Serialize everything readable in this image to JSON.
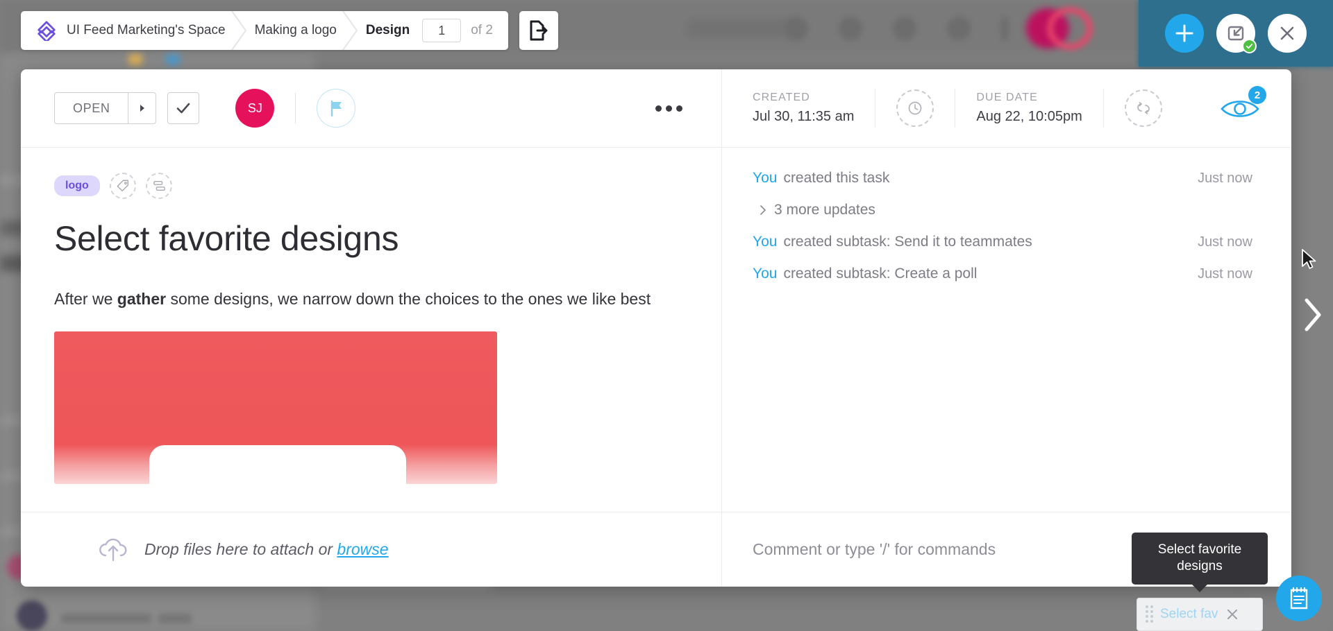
{
  "breadcrumb": {
    "items": [
      {
        "label": "UI Feed Marketing's Space",
        "active": false
      },
      {
        "label": "Making a logo",
        "active": false
      },
      {
        "label": "Design",
        "active": true
      }
    ],
    "page_value": "1",
    "page_total": "of 2",
    "export_icon": "export-document-icon"
  },
  "action_cluster": {
    "add_label": "+",
    "add_icon": "plus-icon",
    "minimize_icon": "minimize-task-icon",
    "minimize_status_icon": "green-check-badge",
    "close_icon": "close-x-icon"
  },
  "task_header": {
    "status_label": "OPEN",
    "status_caret_icon": "caret-right-icon",
    "complete_icon": "checkmark-icon",
    "avatar_initials": "SJ",
    "flag_icon": "flag-icon",
    "more_icon": "ellipsis-icon",
    "created_label": "CREATED",
    "created_value": "Jul 30, 11:35 am",
    "time_estimate_icon": "clock-icon",
    "due_label": "DUE DATE",
    "due_value": "Aug 22, 10:05pm",
    "recurring_icon": "repeat-icon",
    "watch_icon": "eye-icon",
    "watch_count": "2"
  },
  "task_body": {
    "tag": "logo",
    "add_tag_icon": "tag-icon",
    "add_field_icon": "custom-field-icon",
    "title": "Select favorite designs",
    "description_prefix": "After we ",
    "description_bold": "gather",
    "description_suffix": " some designs, we narrow down the choices to the ones we like best",
    "attachment_preview": "design-thumbnail",
    "dropzone_icon": "upload-cloud-icon",
    "dropzone_text": "Drop files here to attach or ",
    "dropzone_link": "browse"
  },
  "activity": {
    "items": [
      {
        "who": "You",
        "what": "created this task",
        "when": "Just now"
      },
      {
        "who": "You",
        "what": "created subtask: Send it to teammates",
        "when": "Just now"
      },
      {
        "who": "You",
        "what": "created subtask: Create a poll",
        "when": "Just now"
      }
    ],
    "more_updates": "3 more updates",
    "more_icon": "chevron-right-icon"
  },
  "comment": {
    "placeholder": "Comment or type '/' for commands"
  },
  "tooltip": {
    "text": "Select favorite designs"
  },
  "drag_chip": {
    "label": "Select fav",
    "grip_icon": "drag-grip-icon",
    "close_icon": "close-x-icon"
  },
  "fab": {
    "icon": "notepad-icon"
  },
  "next_nav": {
    "icon": "chevron-right-icon"
  },
  "colors": {
    "accent_blue": "#22a7ea",
    "avatar_pink": "#e5125b",
    "tag_purple": "#6b4fe0",
    "tag_bg": "#ddd7fb",
    "header_panel": "#2e6f8d",
    "image_red": "#ee5659"
  }
}
